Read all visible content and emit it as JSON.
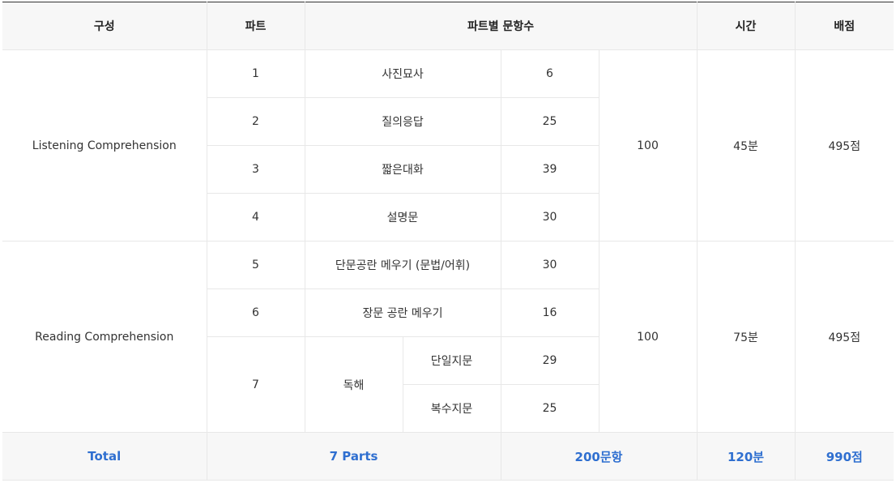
{
  "headers": {
    "composition": "구성",
    "part": "파트",
    "questions_per_part": "파트별 문항수",
    "time": "시간",
    "score": "배점"
  },
  "listening": {
    "label": "Listening Comprehension",
    "subtotal": "100",
    "time": "45분",
    "score": "495점",
    "parts": [
      {
        "num": "1",
        "name": "사진묘사",
        "count": "6"
      },
      {
        "num": "2",
        "name": "질의응답",
        "count": "25"
      },
      {
        "num": "3",
        "name": "짧은대화",
        "count": "39"
      },
      {
        "num": "4",
        "name": "설명문",
        "count": "30"
      }
    ]
  },
  "reading": {
    "label": "Reading Comprehension",
    "subtotal": "100",
    "time": "75분",
    "score": "495점",
    "parts": [
      {
        "num": "5",
        "name": "단문공란 메우기 (문법/어휘)",
        "count": "30"
      },
      {
        "num": "6",
        "name": "장문 공란 메우기",
        "count": "16"
      }
    ],
    "part7": {
      "num": "7",
      "name": "독해",
      "sub": [
        {
          "name": "단일지문",
          "count": "29"
        },
        {
          "name": "복수지문",
          "count": "25"
        }
      ]
    }
  },
  "total": {
    "label": "Total",
    "parts": "7 Parts",
    "questions": "200문항",
    "time": "120분",
    "score": "990점"
  }
}
